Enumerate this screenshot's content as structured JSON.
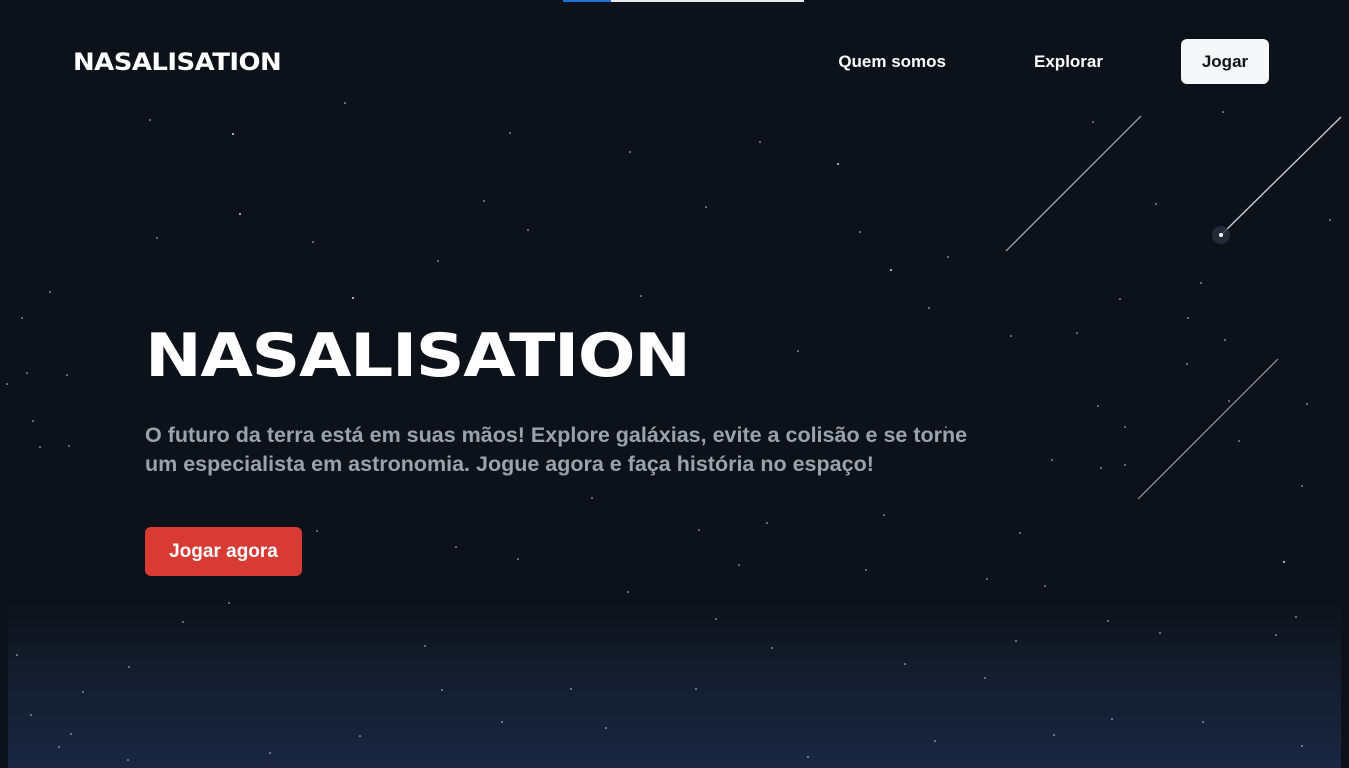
{
  "brand": {
    "logo_text": "NASALISATION"
  },
  "nav": {
    "items": [
      {
        "label": "Quem somos"
      },
      {
        "label": "Explorar"
      }
    ],
    "cta_label": "Jogar"
  },
  "loader": {
    "progress": 0.2
  },
  "hero": {
    "title": "NASALISATION",
    "description": "O futuro da terra está em suas mãos! Explore galáxias, evite a colisão e se torne um especialista em astronomia. Jogue agora e faça história no espaço!",
    "cta_label": "Jogar agora"
  },
  "colors": {
    "background": "#0d1119",
    "primary_button": "#d83a34",
    "nav_button": "#f6f7f9",
    "description_text": "#9aa2ad",
    "loader_fill": "#1e6fd6"
  }
}
